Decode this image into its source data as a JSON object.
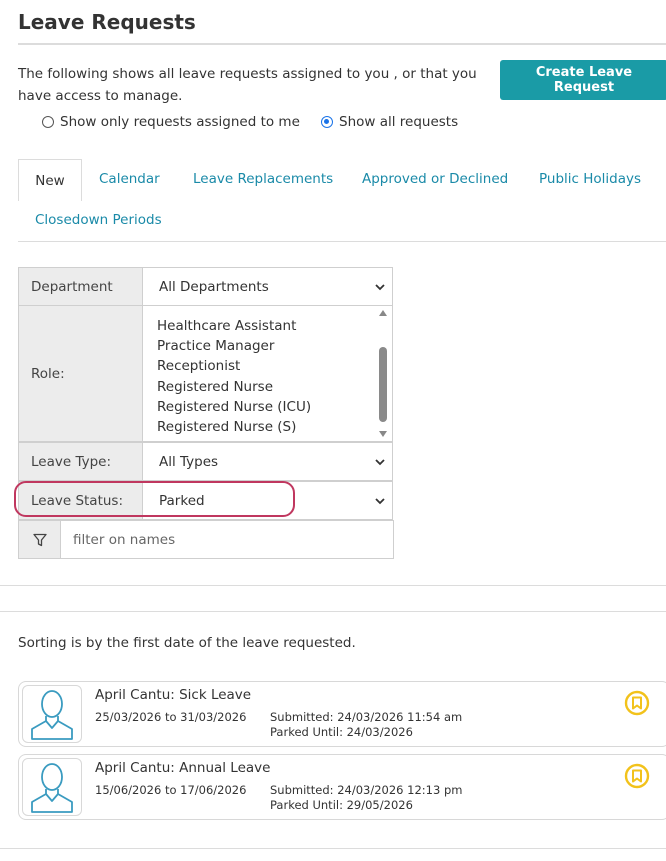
{
  "page": {
    "title": "Leave Requests",
    "intro_text": "The following shows all leave requests assigned to you , or that you have access to manage.",
    "create_button_label": "Create Leave Request"
  },
  "view_options": {
    "assigned_only_label": "Show only requests assigned to me",
    "show_all_label": "Show all requests",
    "selected": "Show all requests"
  },
  "tabs": [
    {
      "label": "New",
      "active": true
    },
    {
      "label": "Calendar",
      "active": false
    },
    {
      "label": "Leave Replacements",
      "active": false
    },
    {
      "label": "Approved or Declined",
      "active": false
    },
    {
      "label": "Public Holidays",
      "active": false
    },
    {
      "label": "Closedown Periods",
      "active": false
    }
  ],
  "filters": {
    "department": {
      "label": "Department",
      "value": "All Departments"
    },
    "role": {
      "label": "Role:",
      "options": [
        "Healthcare Assistant",
        "Practice Manager",
        "Receptionist",
        "Registered Nurse",
        "Registered Nurse (ICU)",
        "Registered Nurse (S)"
      ]
    },
    "leave_type": {
      "label": "Leave Type:",
      "value": "All Types"
    },
    "leave_status": {
      "label": "Leave Status:",
      "value": "Parked"
    },
    "name_filter": {
      "placeholder": "filter on names",
      "value": ""
    }
  },
  "sorting_note": "Sorting is by the first date of the leave requested.",
  "requests": [
    {
      "title": "April Cantu: Sick Leave",
      "dates": "25/03/2026 to 31/03/2026",
      "submitted": "Submitted: 24/03/2026 11:54 am",
      "parked_until": "Parked Until: 24/03/2026"
    },
    {
      "title": "April Cantu: Annual Leave",
      "dates": "15/06/2026 to 17/06/2026",
      "submitted": "Submitted: 24/03/2026 12:13 pm",
      "parked_until": "Parked Until: 29/05/2026"
    }
  ],
  "icons": {
    "avatar": "user-avatar-icon",
    "badge": "parked-badge-icon",
    "filter": "funnel-icon",
    "dropdown": "chevron-down-icon"
  },
  "colors": {
    "accent": "#1a9ba6",
    "link": "#1a8aa8",
    "highlight_outline": "#c0375f",
    "badge": "#f2c21b",
    "avatar_stroke": "#3a9bc0"
  }
}
